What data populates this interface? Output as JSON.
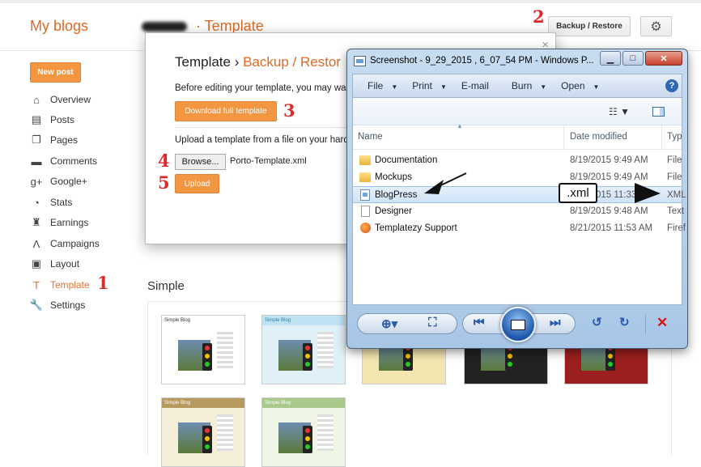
{
  "header": {
    "brand": "My blogs",
    "blog_title": "Template",
    "backup_label": "Backup / Restore",
    "settings_icon": "gear-icon"
  },
  "sidebar": {
    "new_post": "New post",
    "items": [
      {
        "label": "Overview",
        "icon": "home-icon"
      },
      {
        "label": "Posts",
        "icon": "posts-icon"
      },
      {
        "label": "Pages",
        "icon": "pages-icon"
      },
      {
        "label": "Comments",
        "icon": "comments-icon"
      },
      {
        "label": "Google+",
        "icon": "googleplus-icon"
      },
      {
        "label": "Stats",
        "icon": "stats-icon"
      },
      {
        "label": "Earnings",
        "icon": "trophy-icon"
      },
      {
        "label": "Campaigns",
        "icon": "campaigns-icon"
      },
      {
        "label": "Layout",
        "icon": "layout-icon"
      },
      {
        "label": "Template",
        "icon": "paint-roller-icon"
      },
      {
        "label": "Settings",
        "icon": "wrench-icon"
      }
    ],
    "active": "Template"
  },
  "dialog": {
    "title": "Template",
    "breadcrumb": "Backup / Restor",
    "close": "×",
    "text1": "Before editing your template, you may want",
    "download_label": "Download full template",
    "text2": "Upload a template from a file on your hard d",
    "browse_label": "Browse...",
    "file_name": "Porto-Template.xml",
    "upload_label": "Upload"
  },
  "steps": {
    "s1": "1",
    "s2": "2",
    "s3": "3",
    "s4": "4",
    "s5": "5"
  },
  "gallery": {
    "section_title": "Simple",
    "thumbs": [
      {
        "label": "Simple Blog",
        "style": "white"
      },
      {
        "label": "Simple Blog",
        "style": "blue"
      },
      {
        "label": "",
        "style": "yellow"
      },
      {
        "label": "",
        "style": "dark"
      },
      {
        "label": "",
        "style": "red"
      },
      {
        "label": "Simple Blog",
        "style": "tan"
      },
      {
        "label": "Simple Blog",
        "style": "green"
      }
    ]
  },
  "viewer": {
    "title": "Screenshot - 9_29_2015 , 6_07_54 PM - Windows P...",
    "menu": [
      {
        "label": "File",
        "arrow": true
      },
      {
        "label": "Print",
        "arrow": true
      },
      {
        "label": "E-mail",
        "arrow": false
      },
      {
        "label": "Burn",
        "arrow": true
      },
      {
        "label": "Open",
        "arrow": true
      }
    ],
    "columns": {
      "name": "Name",
      "date": "Date modified",
      "type": "Typ"
    },
    "files": [
      {
        "name": "Documentation",
        "date": "8/19/2015 9:49 AM",
        "type": "File",
        "kind": "folder"
      },
      {
        "name": "Mockups",
        "date": "8/19/2015 9:49 AM",
        "type": "File",
        "kind": "folder"
      },
      {
        "name": "BlogPress",
        "date": "8/19/2015 11:33",
        "type": "XML",
        "kind": "xml",
        "highlight": true
      },
      {
        "name": "Designer",
        "date": "8/19/2015 9:48 AM",
        "type": "Text",
        "kind": "doc"
      },
      {
        "name": "Templatezy Support",
        "date": "8/21/2015 11:53 AM",
        "type": "Firef",
        "kind": "firefox"
      }
    ],
    "annotation": ".xml"
  },
  "colors": {
    "accent": "#dd6a24",
    "button_orange": "#f29642",
    "step_red": "#d92b2b"
  }
}
